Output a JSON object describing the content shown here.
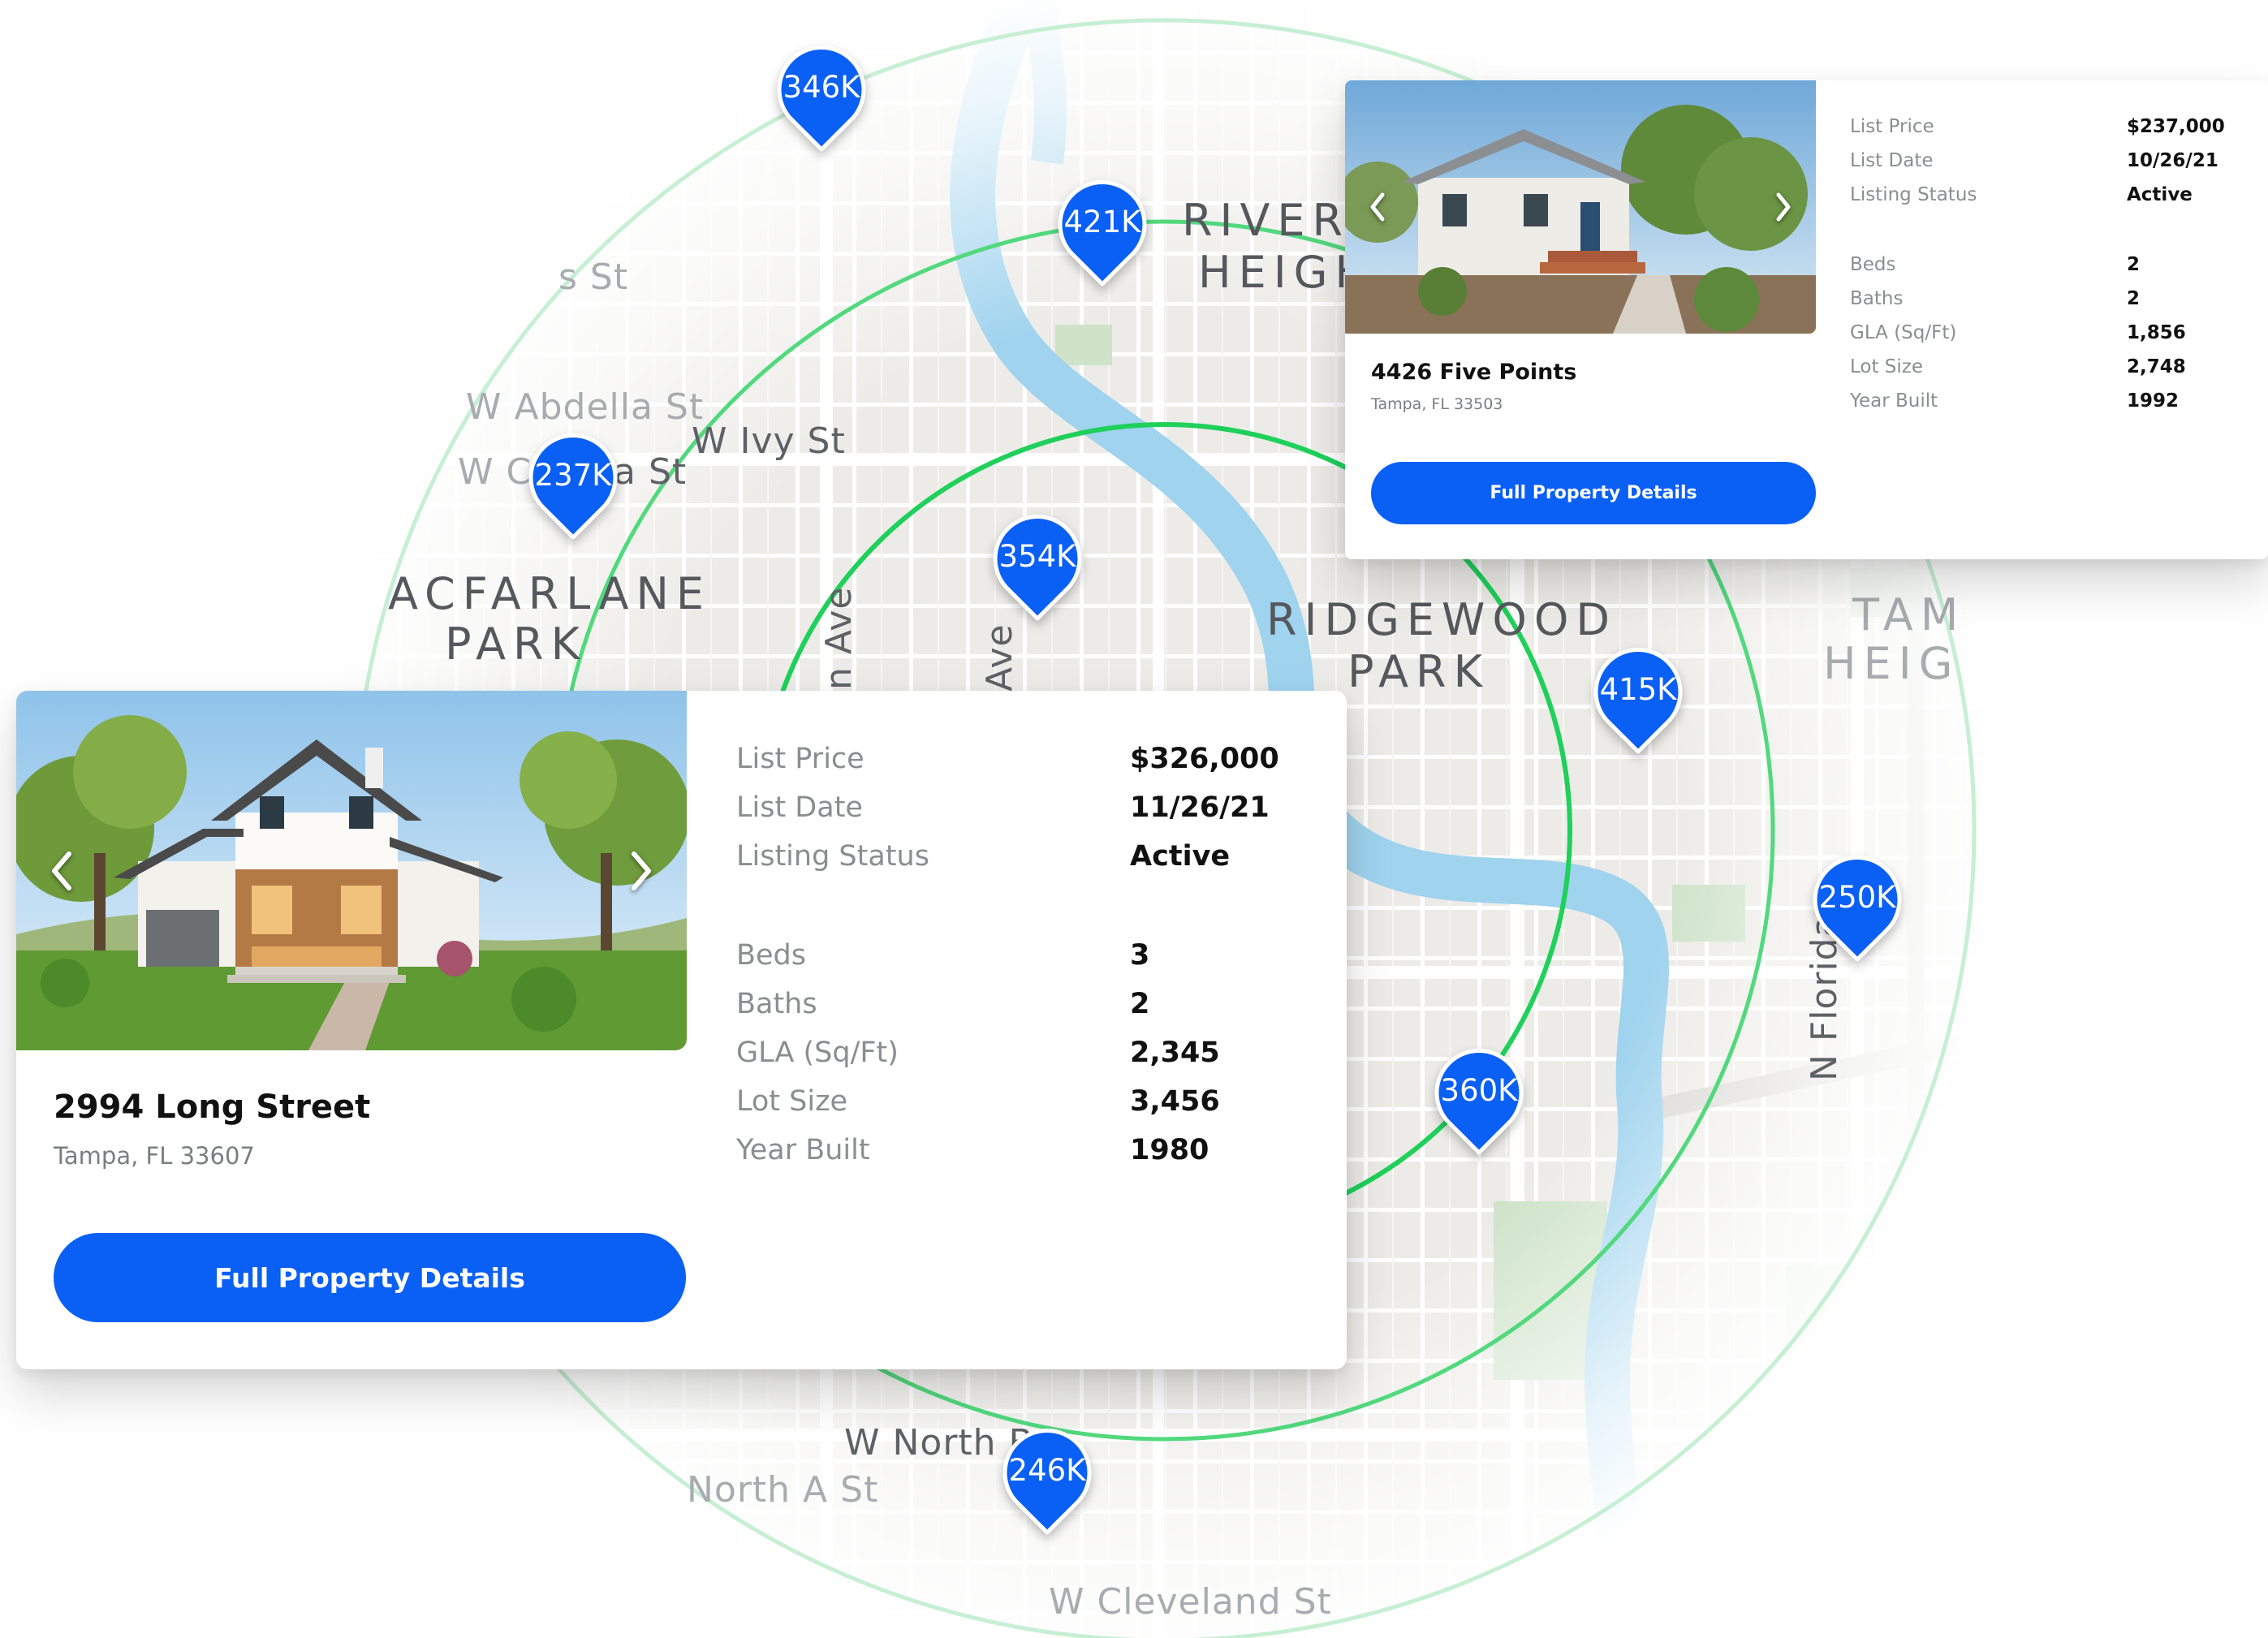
{
  "map": {
    "district_labels": [
      {
        "id": "rivers",
        "text": "RIVERS"
      },
      {
        "id": "heigh",
        "text": "HEIGH"
      },
      {
        "id": "acfarlane",
        "text": "ACFARLANE"
      },
      {
        "id": "park1",
        "text": "PARK"
      },
      {
        "id": "ridgewood",
        "text": "RIDGEWOOD"
      },
      {
        "id": "park2",
        "text": "PARK"
      },
      {
        "id": "tam",
        "text": "TAM"
      },
      {
        "id": "heig",
        "text": "HEIG"
      }
    ],
    "street_labels": [
      {
        "id": "s-st",
        "text": "s St"
      },
      {
        "id": "abdella",
        "text": "W Abdella St"
      },
      {
        "id": "wc",
        "text": "W C"
      },
      {
        "id": "ast",
        "text": "a St"
      },
      {
        "id": "ivy",
        "text": "W Ivy St"
      },
      {
        "id": "ave1",
        "text": "n Ave"
      },
      {
        "id": "ave2",
        "text": "Ave"
      },
      {
        "id": "nflorida",
        "text": "N Florida"
      },
      {
        "id": "wnorth",
        "text": "W North B"
      },
      {
        "id": "northa",
        "text": "North A St"
      },
      {
        "id": "cleveland",
        "text": "W Cleveland St"
      }
    ],
    "pins": [
      {
        "id": "346k",
        "label": "346K"
      },
      {
        "id": "421k",
        "label": "421K"
      },
      {
        "id": "237k",
        "label": "237K"
      },
      {
        "id": "354k",
        "label": "354K"
      },
      {
        "id": "415k",
        "label": "415K"
      },
      {
        "id": "250k",
        "label": "250K"
      },
      {
        "id": "360k",
        "label": "360K"
      },
      {
        "id": "246k",
        "label": "246K"
      }
    ],
    "colors": {
      "pin": "#0a5ff5",
      "ring_inner": "#1fd05a",
      "ring_outer": "#c6efd3",
      "river": "#9fd3ee"
    }
  },
  "main_card": {
    "title": "2994 Long Street",
    "subtitle": "Tampa, FL 33607",
    "button_label": "Full Property Details",
    "specs": [
      {
        "label": "List Price",
        "value": "$326,000"
      },
      {
        "label": "List Date",
        "value": "11/26/21"
      },
      {
        "label": "Listing Status",
        "value": "Active"
      },
      {
        "label": "Beds",
        "value": "3"
      },
      {
        "label": "Baths",
        "value": "2"
      },
      {
        "label": "GLA (Sq/Ft)",
        "value": "2,345"
      },
      {
        "label": "Lot Size",
        "value": "3,456"
      },
      {
        "label": "Year Built",
        "value": "1980"
      }
    ]
  },
  "small_card": {
    "title": "4426 Five Points",
    "subtitle": "Tampa, FL 33503",
    "button_label": "Full Property Details",
    "specs": [
      {
        "label": "List Price",
        "value": "$237,000"
      },
      {
        "label": "List Date",
        "value": "10/26/21"
      },
      {
        "label": "Listing Status",
        "value": "Active"
      },
      {
        "label": "Beds",
        "value": "2"
      },
      {
        "label": "Baths",
        "value": "2"
      },
      {
        "label": "GLA (Sq/Ft)",
        "value": "1,856"
      },
      {
        "label": "Lot Size",
        "value": "2,748"
      },
      {
        "label": "Year Built",
        "value": "1992"
      }
    ]
  },
  "icons": {
    "prev": "chevron-left-icon",
    "next": "chevron-right-icon",
    "pin": "map-pin-icon"
  }
}
